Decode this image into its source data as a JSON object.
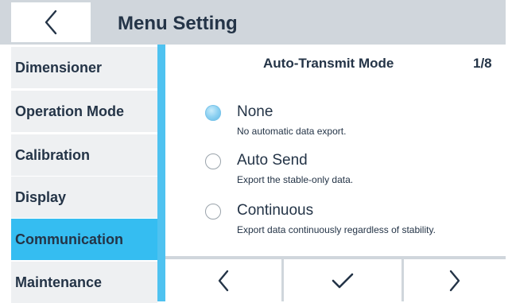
{
  "header": {
    "title": "Menu Setting",
    "back_icon": "chevron-left-icon",
    "background": "#d0d6dc"
  },
  "sidebar": {
    "items": [
      {
        "label": "Dimensioner",
        "active": false
      },
      {
        "label": "Operation Mode",
        "active": false
      },
      {
        "label": "Calibration",
        "active": false
      },
      {
        "label": "Display",
        "active": false
      },
      {
        "label": "Communication",
        "active": true
      },
      {
        "label": "Maintenance",
        "active": false
      }
    ],
    "active_color": "#35bdf1",
    "accent_color": "#4fc2f0"
  },
  "panel": {
    "title": "Auto-Transmit Mode",
    "page": "1/8",
    "options": [
      {
        "label": "None",
        "description": "No automatic data export.",
        "selected": true
      },
      {
        "label": "Auto Send",
        "description": "Export the stable-only data.",
        "selected": false
      },
      {
        "label": "Continuous",
        "description": "Export data continuously regardless of stability.",
        "selected": false
      }
    ]
  },
  "toolbar": {
    "buttons": [
      {
        "icon": "chevron-left-icon"
      },
      {
        "icon": "checkmark-icon"
      },
      {
        "icon": "chevron-right-icon"
      }
    ]
  }
}
